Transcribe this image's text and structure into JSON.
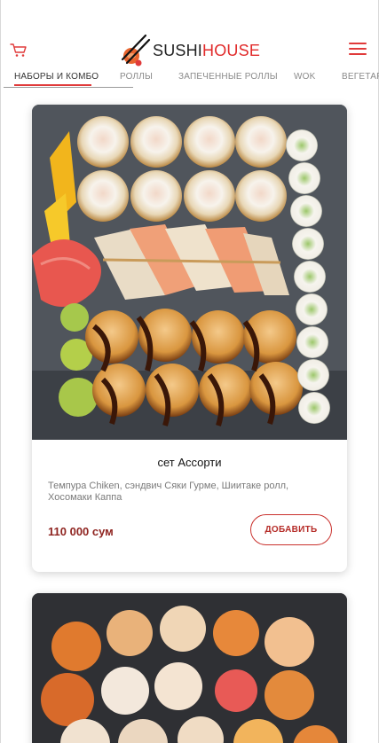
{
  "header": {
    "brand_first": "SUSHI",
    "brand_second": "HOUSE",
    "cart_icon": "cart-icon",
    "menu_icon": "hamburger-menu-icon"
  },
  "tabs": [
    {
      "label": "НАБОРЫ И КОМБО",
      "active": true
    },
    {
      "label": "РОЛЛЫ",
      "active": false
    },
    {
      "label": "ЗАПЕЧЕННЫЕ РОЛЛЫ",
      "active": false
    },
    {
      "label": "WOK",
      "active": false
    },
    {
      "label": "ВЕГЕТАР",
      "active": false
    }
  ],
  "products": [
    {
      "title": "сет Ассорти",
      "description": "Темпура Chiken, сэндвич Сяки Гурме, Шиитаке ролл, Хосомаки Каппа",
      "price": "110 000 сум",
      "add_label": "ДОБАВИТЬ"
    }
  ],
  "colors": {
    "accent": "#e12a2a",
    "price": "#8f2420"
  }
}
